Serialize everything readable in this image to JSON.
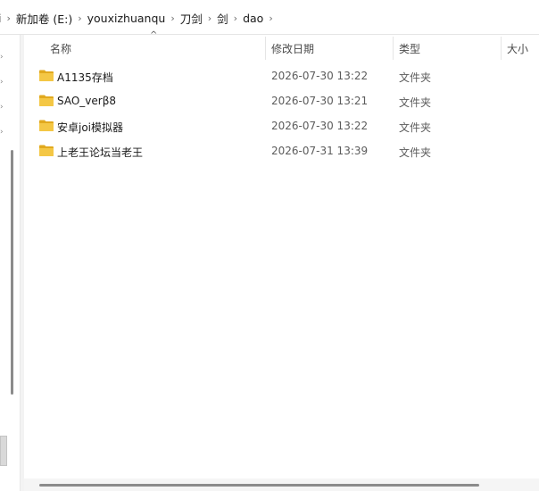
{
  "breadcrumb": {
    "items": [
      "i",
      "新加卷 (E:)",
      "youxizhuanqu",
      "刀剑",
      "剑",
      "dao"
    ],
    "separator": "›"
  },
  "nav": {
    "markers": [
      "›",
      "›",
      "›",
      "›"
    ]
  },
  "columns": {
    "name": "名称",
    "date": "修改日期",
    "type": "类型",
    "size": "大小",
    "sort_indicator": "^"
  },
  "rows": [
    {
      "name": "A1135存档",
      "date": "2026-07-30 13:22",
      "type": "文件夹"
    },
    {
      "name": "SAO_verβ8",
      "date": "2026-07-30 13:21",
      "type": "文件夹"
    },
    {
      "name": "安卓joi模拟器",
      "date": "2026-07-30 13:22",
      "type": "文件夹"
    },
    {
      "name": "上老王论坛当老王",
      "date": "2026-07-31 13:39",
      "type": "文件夹"
    }
  ],
  "colors": {
    "folder": "#f4c745",
    "folder_dark": "#e1a91e"
  }
}
